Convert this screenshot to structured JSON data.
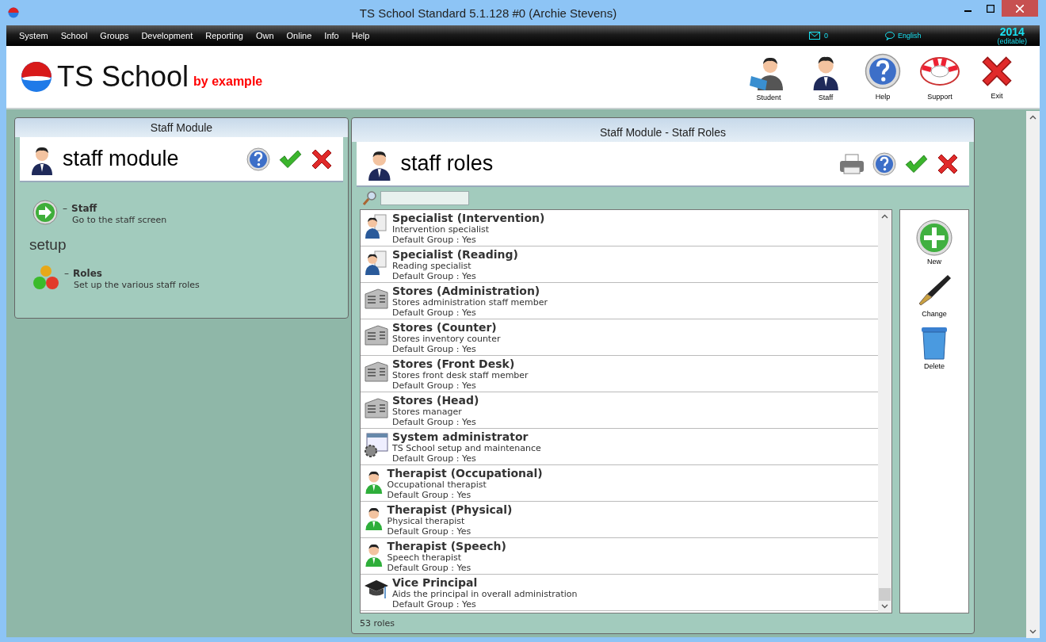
{
  "window": {
    "title": "TS School Standard 5.1.128 #0 (Archie Stevens)"
  },
  "menu": [
    "System",
    "School",
    "Groups",
    "Development",
    "Reporting",
    "Own",
    "Online",
    "Info",
    "Help"
  ],
  "status": {
    "messages": "0",
    "language": "English",
    "year": "2014",
    "year_note": "(editable)"
  },
  "logo": {
    "name": "TS School",
    "tagline": "by example"
  },
  "toolbar": [
    {
      "label": "Student",
      "kind": "student"
    },
    {
      "label": "Staff",
      "kind": "staff"
    },
    {
      "label": "Help",
      "kind": "help"
    },
    {
      "label": "Support",
      "kind": "support"
    },
    {
      "label": "Exit",
      "kind": "exit"
    }
  ],
  "left_panel": {
    "caption": "Staff Module",
    "heading": "staff module",
    "links": [
      {
        "kind": "arrow",
        "dash": "–",
        "title": "Staff",
        "description": "Go to the staff screen"
      }
    ],
    "section": "setup",
    "setup_links": [
      {
        "kind": "balls",
        "dash": "–",
        "title": "Roles",
        "description": "Set up the various staff roles"
      }
    ]
  },
  "right_panel": {
    "caption": "Staff Module - Staff Roles",
    "heading": "staff roles",
    "roles": [
      {
        "kind": "specialist",
        "name": "Specialist (Intervention)",
        "description": "Intervention specialist",
        "default_group": "Default Group : Yes"
      },
      {
        "kind": "specialist",
        "name": "Specialist (Reading)",
        "description": "Reading specialist",
        "default_group": "Default Group : Yes"
      },
      {
        "kind": "stores",
        "name": "Stores (Administration)",
        "description": "Stores administration staff member",
        "default_group": "Default Group : Yes"
      },
      {
        "kind": "stores",
        "name": "Stores (Counter)",
        "description": "Stores inventory counter",
        "default_group": "Default Group : Yes"
      },
      {
        "kind": "stores",
        "name": "Stores (Front Desk)",
        "description": "Stores front desk staff member",
        "default_group": "Default Group : Yes"
      },
      {
        "kind": "stores",
        "name": "Stores (Head)",
        "description": "Stores manager",
        "default_group": "Default Group : Yes"
      },
      {
        "kind": "admin",
        "name": "System administrator",
        "description": "TS School setup and maintenance",
        "default_group": "Default Group : Yes"
      },
      {
        "kind": "therapist",
        "name": "Therapist (Occupational)",
        "description": "Occupational therapist",
        "default_group": "Default Group : Yes"
      },
      {
        "kind": "therapist",
        "name": "Therapist (Physical)",
        "description": "Physical therapist",
        "default_group": "Default Group : Yes"
      },
      {
        "kind": "therapist",
        "name": "Therapist (Speech)",
        "description": "Speech therapist",
        "default_group": "Default Group : Yes"
      },
      {
        "kind": "cap",
        "name": "Vice Principal",
        "description": "Aids the principal in overall administration",
        "default_group": "Default Group : Yes"
      }
    ],
    "actions": [
      {
        "label": "New",
        "kind": "new"
      },
      {
        "label": "Change",
        "kind": "change"
      },
      {
        "label": "Delete",
        "kind": "delete"
      }
    ],
    "count": "53 roles"
  }
}
